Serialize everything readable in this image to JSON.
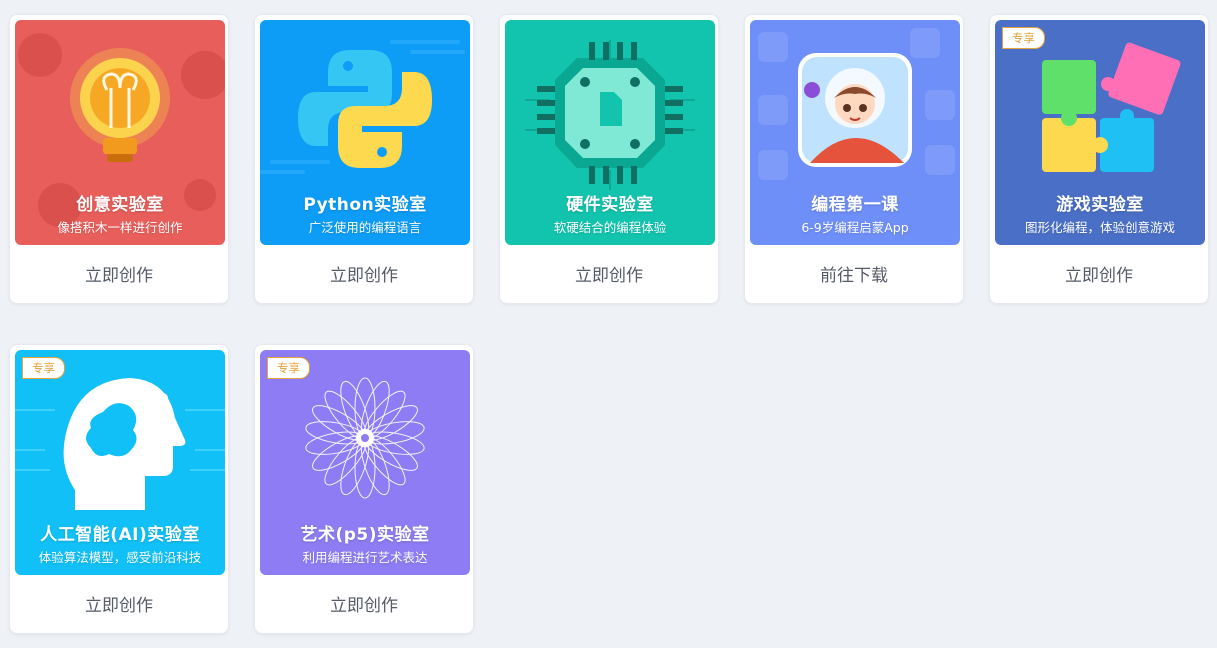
{
  "cards": [
    {
      "title": "创意实验室",
      "subtitle": "像搭积木一样进行创作",
      "action": "立即创作",
      "badge": "",
      "color": "#e85e5a",
      "icon": "lightbulb-icon"
    },
    {
      "title": "Python实验室",
      "subtitle": "广泛使用的编程语言",
      "action": "立即创作",
      "badge": "",
      "color": "#0d9cf6",
      "icon": "python-icon"
    },
    {
      "title": "硬件实验室",
      "subtitle": "软硬结合的编程体验",
      "action": "立即创作",
      "badge": "",
      "color": "#12c3ad",
      "icon": "chip-icon"
    },
    {
      "title": "编程第一课",
      "subtitle": "6-9岁编程启蒙App",
      "action": "前往下载",
      "badge": "",
      "color": "#6e8ef8",
      "icon": "character-avatar-icon"
    },
    {
      "title": "游戏实验室",
      "subtitle": "图形化编程，体验创意游戏",
      "action": "立即创作",
      "badge": "专享",
      "color": "#4a6fc6",
      "icon": "puzzle-icon"
    },
    {
      "title": "人工智能(AI)实验室",
      "subtitle": "体验算法模型，感受前沿科技",
      "action": "立即创作",
      "badge": "专享",
      "color": "#10c0f6",
      "icon": "ai-head-icon"
    },
    {
      "title": "艺术(p5)实验室",
      "subtitle": "利用编程进行艺术表达",
      "action": "立即创作",
      "badge": "专享",
      "color": "#8d7cf3",
      "icon": "spirograph-icon"
    }
  ]
}
